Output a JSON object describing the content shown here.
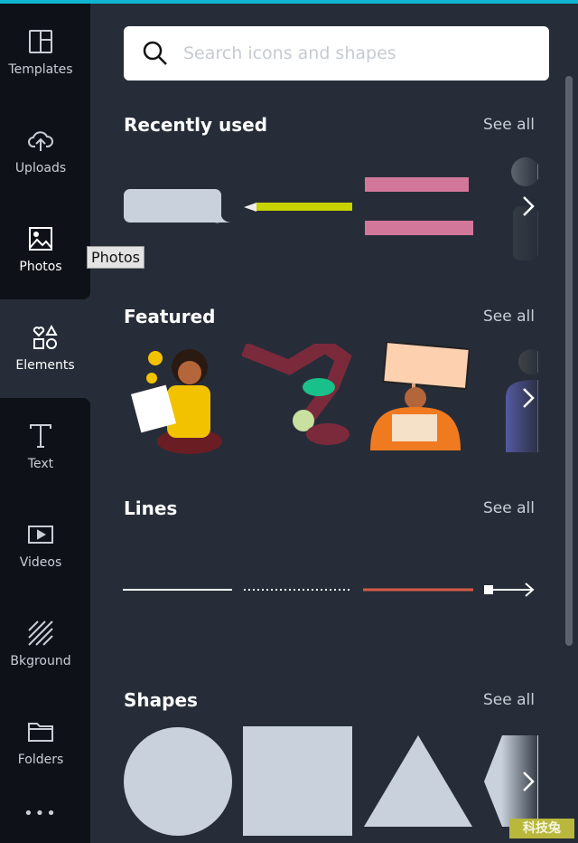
{
  "sidebar": {
    "items": [
      {
        "label": "Templates",
        "icon": "templates-icon"
      },
      {
        "label": "Uploads",
        "icon": "upload-cloud-icon"
      },
      {
        "label": "Photos",
        "icon": "image-icon"
      },
      {
        "label": "Elements",
        "icon": "shapes-icon",
        "active": true
      },
      {
        "label": "Text",
        "icon": "text-icon"
      },
      {
        "label": "Videos",
        "icon": "video-icon"
      },
      {
        "label": "Bkground",
        "icon": "hatch-icon"
      },
      {
        "label": "Folders",
        "icon": "folder-icon"
      }
    ],
    "more": "•••",
    "tooltip": "Photos"
  },
  "search": {
    "placeholder": "Search icons and shapes"
  },
  "sections": [
    {
      "title": "Recently used",
      "see_all": "See all"
    },
    {
      "title": "Featured",
      "see_all": "See all"
    },
    {
      "title": "Lines",
      "see_all": "See all"
    },
    {
      "title": "Shapes",
      "see_all": "See all"
    }
  ],
  "colors": {
    "accent": "#10b6d1",
    "panel": "#262d38",
    "sidebar": "#0e1218",
    "shape": "#c9d2dc"
  },
  "watermark": "科技兔"
}
